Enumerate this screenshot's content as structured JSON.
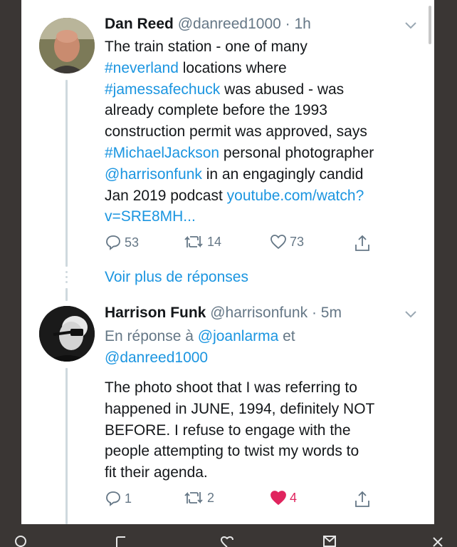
{
  "tweet1": {
    "name": "Dan Reed",
    "handle": "@danreed1000",
    "time": "· 1h",
    "lines": [
      [
        {
          "t": "The train station - one of many",
          "link": false
        }
      ],
      [
        {
          "t": "#neverland",
          "link": true
        },
        {
          "t": " locations where",
          "link": false
        }
      ],
      [
        {
          "t": "#jamessafechuck",
          "link": true
        },
        {
          "t": " was abused - was",
          "link": false
        }
      ],
      [
        {
          "t": "already complete before the 1993",
          "link": false
        }
      ],
      [
        {
          "t": "construction permit was approved, says",
          "link": false
        }
      ],
      [
        {
          "t": "#MichaelJackson",
          "link": true
        },
        {
          "t": " personal photographer",
          "link": false
        }
      ],
      [
        {
          "t": "@harrisonfunk",
          "link": true
        },
        {
          "t": " in an engagingly candid",
          "link": false
        }
      ],
      [
        {
          "t": "Jan 2019 podcast ",
          "link": false
        },
        {
          "t": "youtube.com/watch?",
          "link": true
        }
      ],
      [
        {
          "t": "v=SRE8MH...",
          "link": true
        }
      ]
    ],
    "replies": "53",
    "retweets": "14",
    "likes": "73"
  },
  "more_replies": "Voir plus de réponses",
  "tweet2": {
    "name": "Harrison Funk",
    "handle": "@harrisonfunk",
    "time": "· 5m",
    "reply_prefix": "En réponse à ",
    "reply_to_1": "@joanlarma",
    "reply_and": " et",
    "reply_to_2": "@danreed1000",
    "lines": [
      "The photo shoot that I was referring to",
      "happened in JUNE, 1994, definitely NOT",
      "BEFORE. I refuse to engage with the",
      "people attempting to twist my words to",
      "fit their agenda."
    ],
    "replies": "1",
    "retweets": "2",
    "likes": "4"
  },
  "colors": {
    "link": "#1b95e0",
    "like_active": "#e0245e",
    "muted": "#657786",
    "text": "#14171a",
    "background": "#3a3634"
  },
  "icons": [
    "reply-icon",
    "retweet-icon",
    "like-icon",
    "share-icon",
    "chevron-down-icon",
    "search-icon",
    "notifications-icon",
    "messages-icon",
    "close-icon"
  ]
}
